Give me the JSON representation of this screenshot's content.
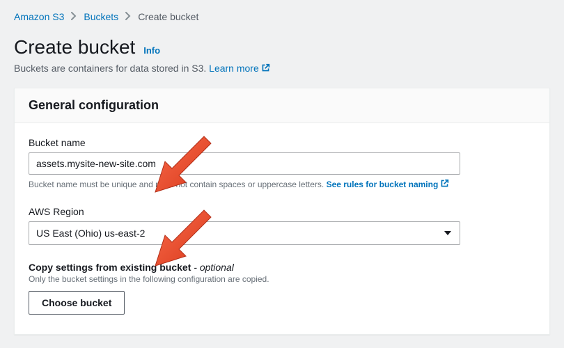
{
  "breadcrumb": {
    "items": [
      {
        "label": "Amazon S3"
      },
      {
        "label": "Buckets"
      },
      {
        "label": "Create bucket"
      }
    ]
  },
  "heading": {
    "title": "Create bucket",
    "info": "Info",
    "subtitle_prefix": "Buckets are containers for data stored in S3. ",
    "learn_more": "Learn more"
  },
  "panel": {
    "title": "General configuration",
    "bucket_name": {
      "label": "Bucket name",
      "value": "assets.mysite-new-site.com",
      "hint_prefix": "Bucket name must be unique and must not contain spaces or uppercase letters. ",
      "hint_link": "See rules for bucket naming"
    },
    "region": {
      "label": "AWS Region",
      "value": "US East (Ohio) us-east-2"
    },
    "copy": {
      "label": "Copy settings from existing bucket",
      "optional_suffix": " - optional",
      "hint": "Only the bucket settings in the following configuration are copied.",
      "button": "Choose bucket"
    }
  }
}
